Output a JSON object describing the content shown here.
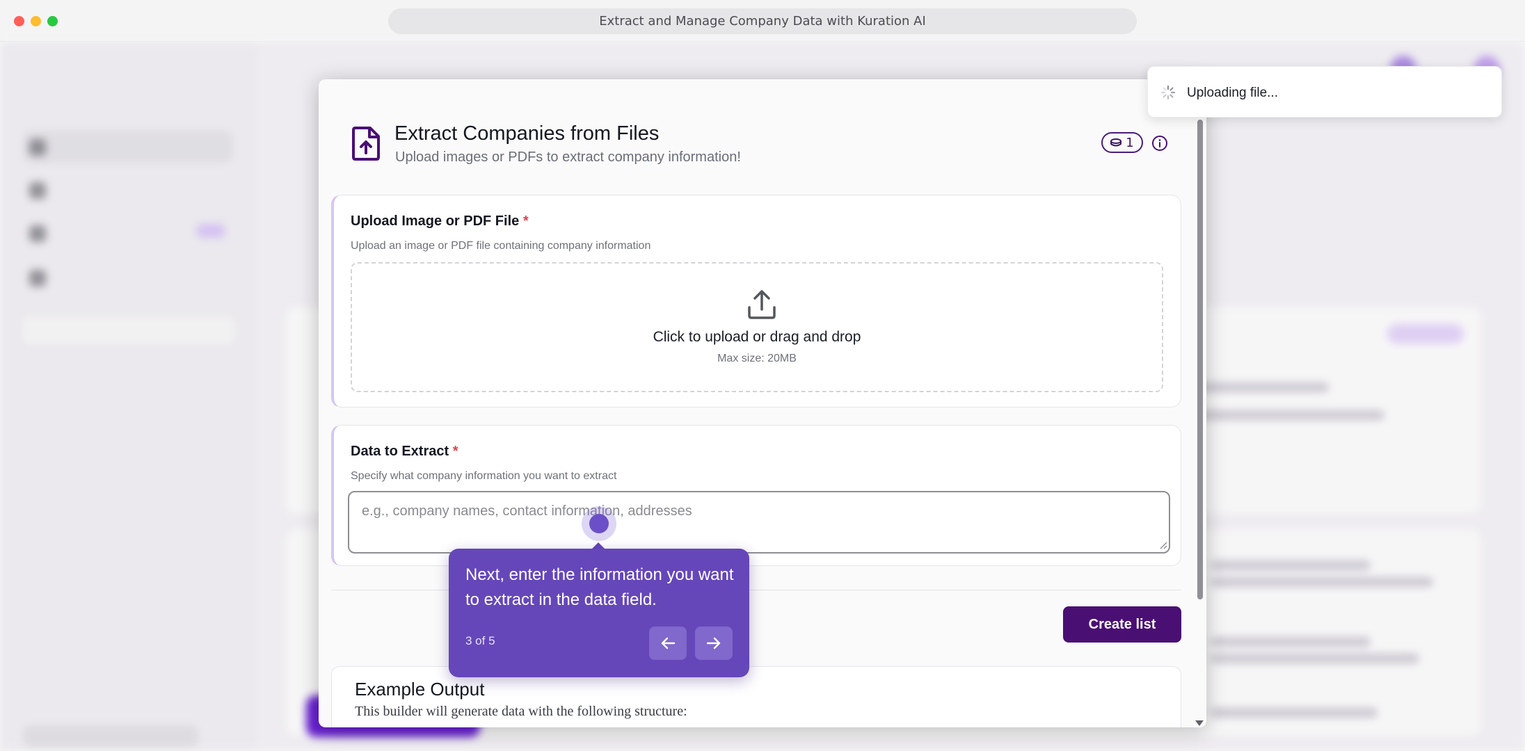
{
  "browser": {
    "tab_title": "Extract and Manage Company Data with Kuration AI"
  },
  "modal": {
    "title": "Extract Companies from Files",
    "subtitle": "Upload images or PDFs to extract company information!",
    "credit_count": "1",
    "upload_section": {
      "label": "Upload Image or PDF File",
      "required_mark": "*",
      "hint": "Upload an image or PDF file containing company information",
      "dropzone_main": "Click to upload or drag and drop",
      "dropzone_sub": "Max size: 20MB"
    },
    "data_section": {
      "label": "Data to Extract",
      "required_mark": "*",
      "hint": "Specify what company information you want to extract",
      "placeholder": "e.g., company names, contact information, addresses",
      "value": ""
    },
    "create_button": "Create list",
    "example": {
      "title": "Example Output",
      "subtitle": "This builder will generate data with the following structure:"
    }
  },
  "tour": {
    "text": "Next, enter the information you want to extract in the data field.",
    "step": "3 of 5",
    "prev_icon": "arrow-left-icon",
    "next_icon": "arrow-right-icon"
  },
  "toast": {
    "text": "Uploading file...",
    "icon": "spinner-icon"
  },
  "colors": {
    "brand_purple": "#4a0f73",
    "tour_purple": "#6547b9",
    "required_red": "#e0414b"
  }
}
